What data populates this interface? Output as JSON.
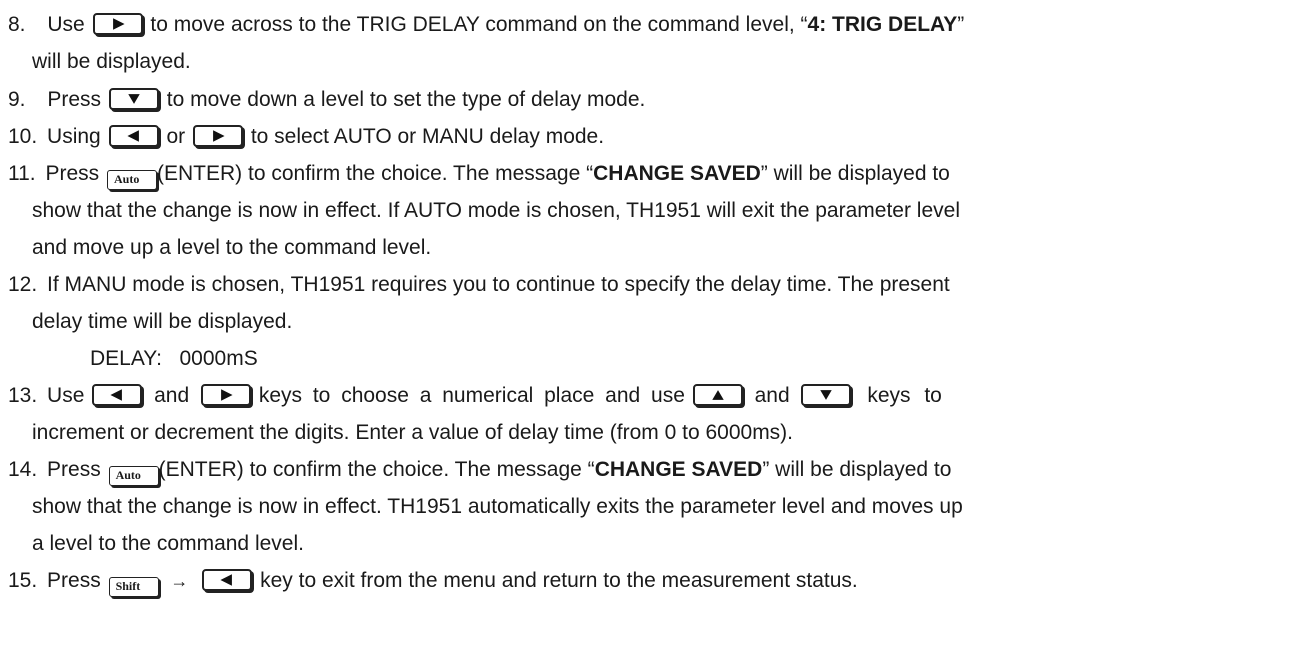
{
  "steps": {
    "s8": {
      "num": "8.",
      "a": "Use",
      "b": "to move across to the TRIG DELAY command on the command level, “",
      "bold": "4: TRIG DELAY",
      "c": "”",
      "d": "will be displayed."
    },
    "s9": {
      "num": "9.",
      "a": "Press",
      "b": "to move down a level to set the type of delay mode."
    },
    "s10": {
      "num": "10.",
      "a": "Using",
      "or": "or",
      "b": "to select AUTO or MANU delay mode."
    },
    "s11": {
      "num": "11.",
      "a": "Press",
      "b": "(ENTER) to confirm the choice. The message “",
      "bold": "CHANGE SAVED",
      "c": "” will be displayed to",
      "l2": "show that the change is now in effect. If AUTO mode is chosen, TH1951 will exit the parameter level",
      "l3": "and move up a level to the command level."
    },
    "s12": {
      "num": "12.",
      "l1": "If MANU mode is chosen, TH1951 requires you to continue to specify the delay time. The present",
      "l2": "delay time will be displayed.",
      "display": "DELAY:   0000mS"
    },
    "s13": {
      "num": "13.",
      "a": "Use",
      "and1": "and",
      "b": "keys to choose a numerical place and use",
      "and2": "and",
      "c": "keys to",
      "l2": "increment or decrement the digits. Enter a value of delay time (from 0 to 6000ms)."
    },
    "s14": {
      "num": "14.",
      "a": "Press",
      "b": "(ENTER) to confirm the choice. The message “",
      "bold": "CHANGE SAVED",
      "c": "” will be displayed to",
      "l2": "show that the change is now in effect. TH1951 automatically exits the parameter level and moves up",
      "l3": "a level to the command level."
    },
    "s15": {
      "num": "15.",
      "a": "Press",
      "arrow": "→",
      "b": "key to exit from the menu and return to the measurement status."
    }
  },
  "keys": {
    "auto": "Auto",
    "shift": "Shift"
  },
  "icons": [
    "right-arrow-key-icon",
    "left-arrow-key-icon",
    "up-arrow-key-icon",
    "down-arrow-key-icon"
  ]
}
